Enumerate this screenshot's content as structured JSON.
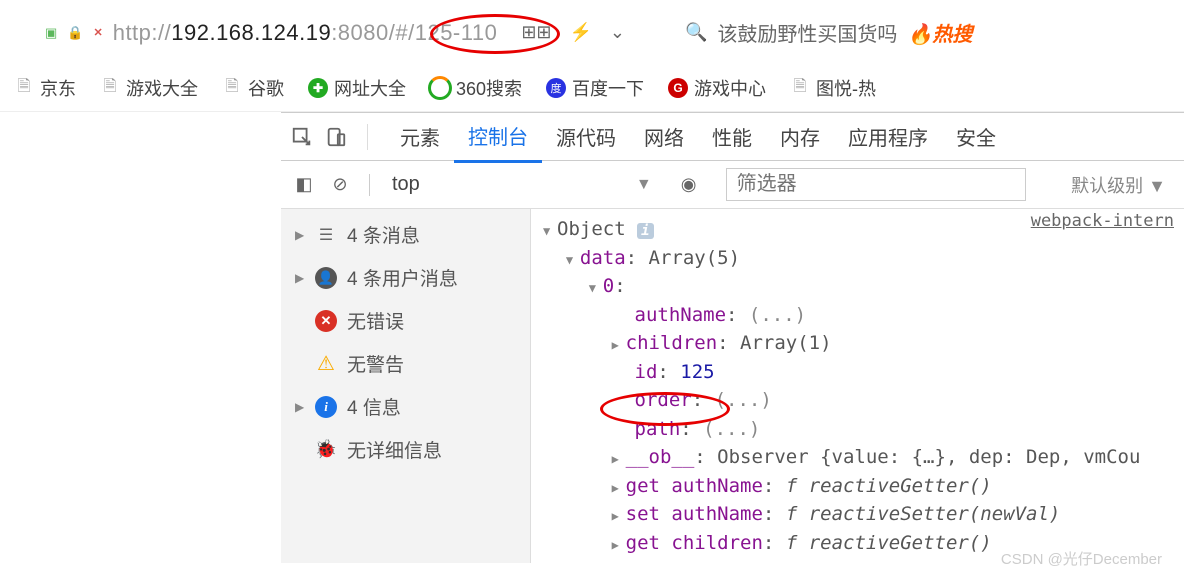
{
  "addressBar": {
    "protocol": "http://",
    "ip": "192.168.124.19",
    "port": ":8080",
    "path": "/#",
    "highlighted": "/125-110"
  },
  "searchBox": {
    "text": "该鼓励野性买国货吗",
    "hotLabel": "热搜"
  },
  "bookmarks": [
    {
      "label": "京东",
      "icon": "file"
    },
    {
      "label": "游戏大全",
      "icon": "file"
    },
    {
      "label": "谷歌",
      "icon": "file"
    },
    {
      "label": "网址大全",
      "icon": "360wz"
    },
    {
      "label": "360搜索",
      "icon": "360so"
    },
    {
      "label": "百度一下",
      "icon": "baidu"
    },
    {
      "label": "游戏中心",
      "icon": "game"
    },
    {
      "label": "图悦-热",
      "icon": "file"
    }
  ],
  "devtools": {
    "tabs": [
      "元素",
      "控制台",
      "源代码",
      "网络",
      "性能",
      "内存",
      "应用程序",
      "安全"
    ],
    "activeTab": 1,
    "toolbar": {
      "context": "top",
      "filterPlaceholder": "筛选器",
      "levelLabel": "默认级别"
    },
    "sidebar": [
      {
        "type": "msg",
        "label": "4 条消息",
        "arrow": true
      },
      {
        "type": "user",
        "label": "4 条用户消息",
        "arrow": true
      },
      {
        "type": "err",
        "label": "无错误",
        "arrow": false
      },
      {
        "type": "warn",
        "label": "无警告",
        "arrow": false
      },
      {
        "type": "info",
        "label": "4 信息",
        "arrow": true
      },
      {
        "type": "bug",
        "label": "无详细信息",
        "arrow": false
      }
    ],
    "topLink": "webpack-intern",
    "console": {
      "object": "Object",
      "data": "data: Array(5)",
      "idx": "0:",
      "authName": "authName: (...)",
      "children": "children: Array(1)",
      "idKey": "id",
      "idVal": "125",
      "order": "order: (...)",
      "path": "path: (...)",
      "ob": "__ob__: Observer {value: {…}, dep: Dep, vmCou",
      "getAuth": "get authName: ",
      "getAuthFn": "f reactiveGetter()",
      "setAuth": "set authName: ",
      "setAuthFn": "f reactiveSetter(newVal)",
      "getCh": "get children: ",
      "getChFn": "f reactiveGetter()"
    }
  },
  "watermark": "CSDN @光仔December"
}
